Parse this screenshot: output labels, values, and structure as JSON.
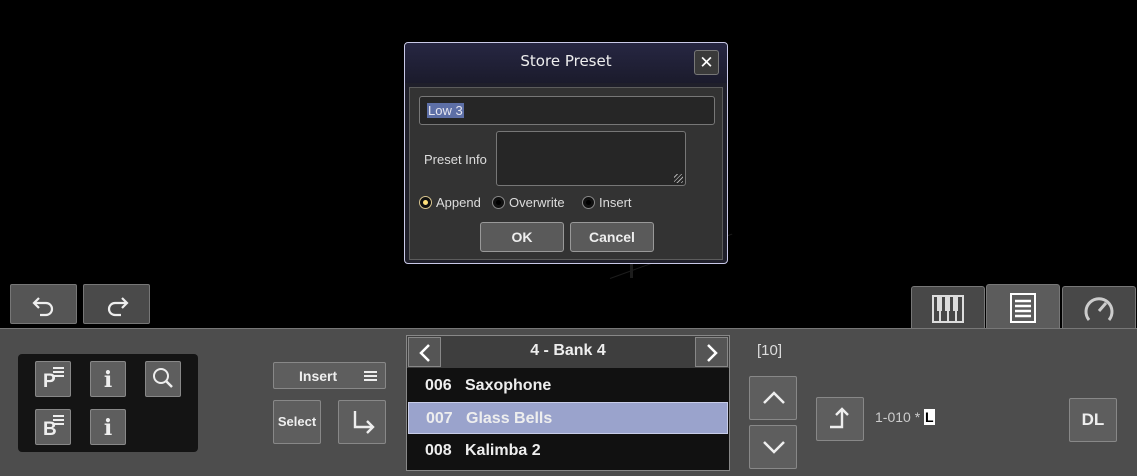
{
  "dialog": {
    "title": "Store Preset",
    "close_glyph": "✕",
    "name_value": "Low 3",
    "info_label": "Preset Info",
    "info_value": "",
    "modes": [
      {
        "label": "Append",
        "selected": true
      },
      {
        "label": "Overwrite",
        "selected": false
      },
      {
        "label": "Insert",
        "selected": false
      }
    ],
    "ok_label": "OK",
    "cancel_label": "Cancel"
  },
  "toolbar": {
    "undo_icon": "undo-arrow-icon",
    "redo_icon": "redo-arrow-icon"
  },
  "tabs": [
    {
      "icon": "piano-keyboard-icon",
      "active": false
    },
    {
      "icon": "preset-list-icon",
      "active": true
    },
    {
      "icon": "dial-icon",
      "active": false
    }
  ],
  "panel": {
    "icon_buttons": {
      "preset_letter": "P",
      "bank_letter": "B",
      "info_glyph": "i"
    },
    "insert_label": "Insert",
    "select_label": "Select",
    "bank_title": "4 - Bank 4",
    "presets": [
      {
        "num": "006",
        "name": "Saxophone",
        "selected": false
      },
      {
        "num": "007",
        "name": "Glass Bells",
        "selected": true
      },
      {
        "num": "008",
        "name": "Kalimba 2",
        "selected": false
      }
    ],
    "count": "[10]",
    "position": "1-010 *",
    "cursor_char": "L",
    "dl_label": "DL"
  },
  "colors": {
    "selection": "#9aa3cc",
    "radio_on": "#ffe07a",
    "dialog_border": "#c9c9e8"
  }
}
